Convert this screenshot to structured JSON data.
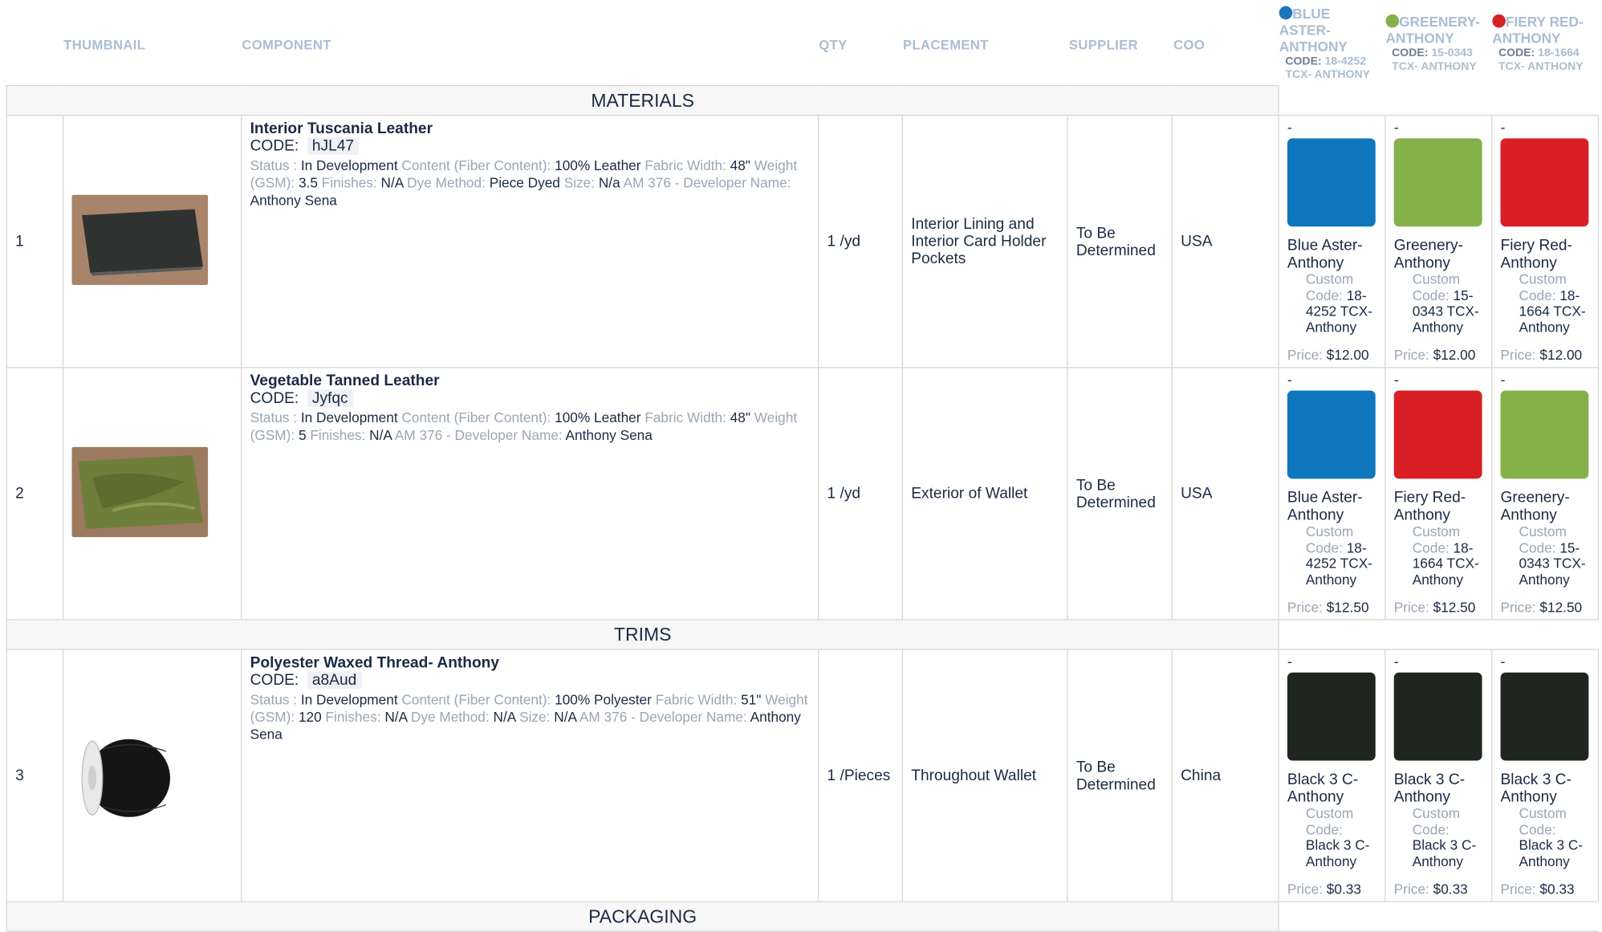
{
  "header": {
    "thumbnail": "THUMBNAIL",
    "component": "COMPONENT",
    "qty": "QTY",
    "placement": "PLACEMENT",
    "supplier": "SUPPLIER",
    "coo": "COO"
  },
  "colorways": [
    {
      "name": "BLUE ASTER-ANTHONY",
      "code_label": "CODE:",
      "code": "18-4252 TCX- ANTHONY",
      "dot": "#1a75bb"
    },
    {
      "name": "GREENERY-ANTHONY",
      "code_label": "CODE:",
      "code": "15-0343 TCX- ANTHONY",
      "dot": "#86b04a"
    },
    {
      "name": "FIERY RED-ANTHONY",
      "code_label": "CODE:",
      "code": "18-1664 TCX- ANTHONY",
      "dot": "#d62027"
    }
  ],
  "sections": {
    "materials": "MATERIALS",
    "trims": "TRIMS",
    "packaging": "PACKAGING"
  },
  "labels": {
    "code": "CODE:",
    "status": "Status :",
    "content": "Content (Fiber Content):",
    "fabric_width": "Fabric Width:",
    "weight": "Weight (GSM):",
    "finishes": "Finishes:",
    "dye_method": "Dye Method:",
    "size": "Size:",
    "am": "AM 376 - Developer Name:",
    "custom_code": "Custom Code:",
    "price": "Price:",
    "dash": "-"
  },
  "rows": [
    {
      "num": "1",
      "name": "Interior Tuscania Leather",
      "code": "hJL47",
      "status": "In Development",
      "content": "100% Leather",
      "fabric_width": "48\"",
      "weight": "3.5",
      "finishes": "N/A",
      "dye_method": "Piece Dyed",
      "size": "N/a",
      "developer": "Anthony Sena",
      "qty": "1 /yd",
      "placement": "Interior Lining and Interior Card Holder Pockets",
      "supplier": "To Be Determined",
      "coo": "USA",
      "thumb_color": "#3a3d3b",
      "colors": [
        {
          "swatch": "#0e76bc",
          "name": "Blue Aster-Anthony",
          "custom_code": "18-4252 TCX-Anthony",
          "price": "$12.00"
        },
        {
          "swatch": "#85b04a",
          "name": "Greenery-Anthony",
          "custom_code": "15-0343 TCX-Anthony",
          "price": "$12.00"
        },
        {
          "swatch": "#d81f26",
          "name": "Fiery Red-Anthony",
          "custom_code": "18-1664 TCX-Anthony",
          "price": "$12.00"
        }
      ]
    },
    {
      "num": "2",
      "name": "Vegetable Tanned Leather",
      "code": "Jyfqc",
      "status": "In Development",
      "content": "100% Leather",
      "fabric_width": "48\"",
      "weight": "5",
      "finishes": "N/A",
      "developer": "Anthony Sena",
      "qty": "1 /yd",
      "placement": "Exterior of Wallet",
      "supplier": "To Be Determined",
      "coo": "USA",
      "thumb_color": "#6b7a3a",
      "colors": [
        {
          "swatch": "#0e76bc",
          "name": "Blue Aster-Anthony",
          "custom_code": "18-4252 TCX-Anthony",
          "price": "$12.50"
        },
        {
          "swatch": "#d81f26",
          "name": "Fiery Red-Anthony",
          "custom_code": "18-1664 TCX-Anthony",
          "price": "$12.50"
        },
        {
          "swatch": "#85b04a",
          "name": "Greenery-Anthony",
          "custom_code": "15-0343 TCX-Anthony",
          "price": "$12.50"
        }
      ]
    },
    {
      "num": "3",
      "name": "Polyester Waxed Thread- Anthony",
      "code": "a8Aud",
      "status": "In Development",
      "content": "100% Polyester",
      "fabric_width": "51\"",
      "weight": "120",
      "finishes": "N/A",
      "dye_method": "N/A",
      "size": "N/A",
      "developer": "Anthony Sena",
      "qty": "1 /Pieces",
      "placement": "Throughout Wallet",
      "supplier": "To Be Determined",
      "coo": "China",
      "thumb_color": "#111111",
      "colors": [
        {
          "swatch": "#1f2620",
          "name": "Black 3 C-Anthony",
          "custom_code": "Black 3 C-Anthony",
          "price": "$0.33"
        },
        {
          "swatch": "#1f2620",
          "name": "Black 3 C-Anthony",
          "custom_code": "Black 3 C-Anthony",
          "price": "$0.33"
        },
        {
          "swatch": "#1f2620",
          "name": "Black 3 C-Anthony",
          "custom_code": "Black 3 C-Anthony",
          "price": "$0.33"
        }
      ]
    }
  ]
}
